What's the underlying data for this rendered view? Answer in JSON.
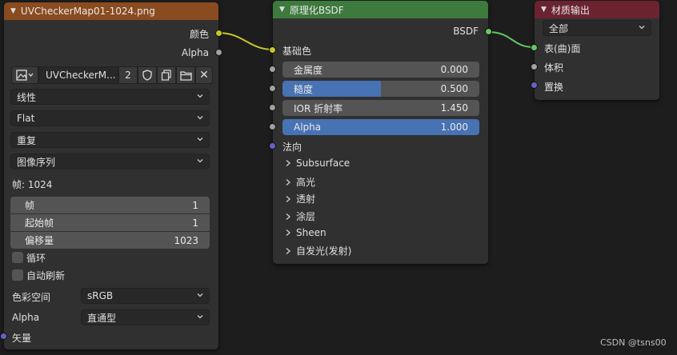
{
  "image_node": {
    "title": "UVCheckerMap01-1024.png",
    "header_color": "#8a4b1f",
    "outputs": [
      "颜色",
      "Alpha"
    ],
    "image_name": "UVCheckerM...",
    "user_count": "2",
    "interpolation": "线性",
    "projection": "Flat",
    "extension": "重复",
    "source": "图像序列",
    "frames_label": "帧: 1024",
    "frame_fields": [
      {
        "label": "帧",
        "value": "1"
      },
      {
        "label": "起始帧",
        "value": "1"
      },
      {
        "label": "偏移量",
        "value": "1023"
      }
    ],
    "cyclic_label": "循环",
    "auto_refresh_label": "自动刷新",
    "color_space_label": "色彩空间",
    "color_space_value": "sRGB",
    "alpha_label": "Alpha",
    "alpha_value": "直通型",
    "vector_label": "矢量"
  },
  "bsdf_node": {
    "title": "原理化BSDF",
    "header_color": "#3d7a3d",
    "output": "BSDF",
    "base_color_label": "基础色",
    "fields": [
      {
        "label": "金属度",
        "value": "0.000",
        "fill": 0.0
      },
      {
        "label": "糙度",
        "value": "0.500",
        "fill": 0.5
      },
      {
        "label": "IOR 折射率",
        "value": "1.450",
        "fill": 0.0
      },
      {
        "label": "Alpha",
        "value": "1.000",
        "fill": 1.0
      }
    ],
    "normal_label": "法向",
    "subpanels": [
      "Subsurface",
      "高光",
      "透射",
      "涂层",
      "Sheen",
      "自发光(发射)"
    ]
  },
  "output_node": {
    "title": "材质输出",
    "header_color": "#6b2330",
    "target": "全部",
    "inputs": [
      "表(曲)面",
      "体积",
      "置换"
    ]
  },
  "watermark": "CSDN @tsns00",
  "colors": {
    "link_yellow": "#c7c729",
    "link_green": "#63c763",
    "accent_blue": "#4772b3"
  }
}
